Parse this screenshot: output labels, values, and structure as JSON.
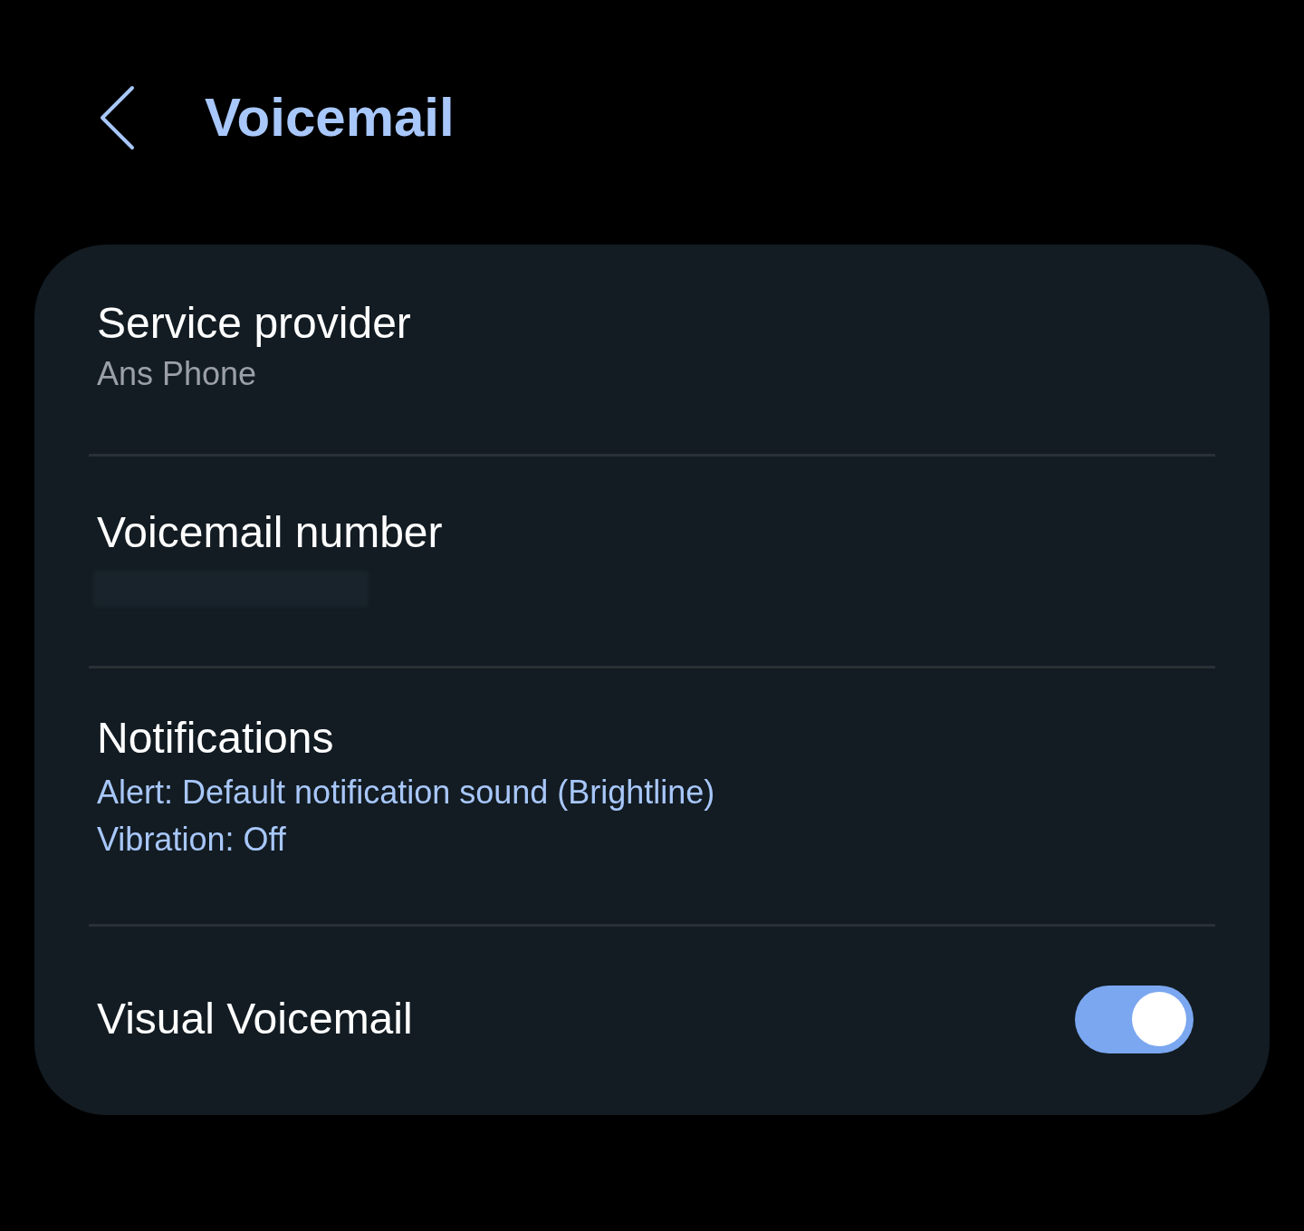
{
  "header": {
    "title": "Voicemail"
  },
  "items": [
    {
      "kind": "value",
      "title": "Service provider",
      "value": "Ans Phone"
    },
    {
      "kind": "hidden",
      "title": "Voicemail number"
    },
    {
      "kind": "info",
      "title": "Notifications",
      "lines": [
        "Alert: Default notification sound (Brightline)",
        "Vibration: Off"
      ]
    },
    {
      "kind": "toggle",
      "title": "Visual Voicemail",
      "on": true
    }
  ]
}
